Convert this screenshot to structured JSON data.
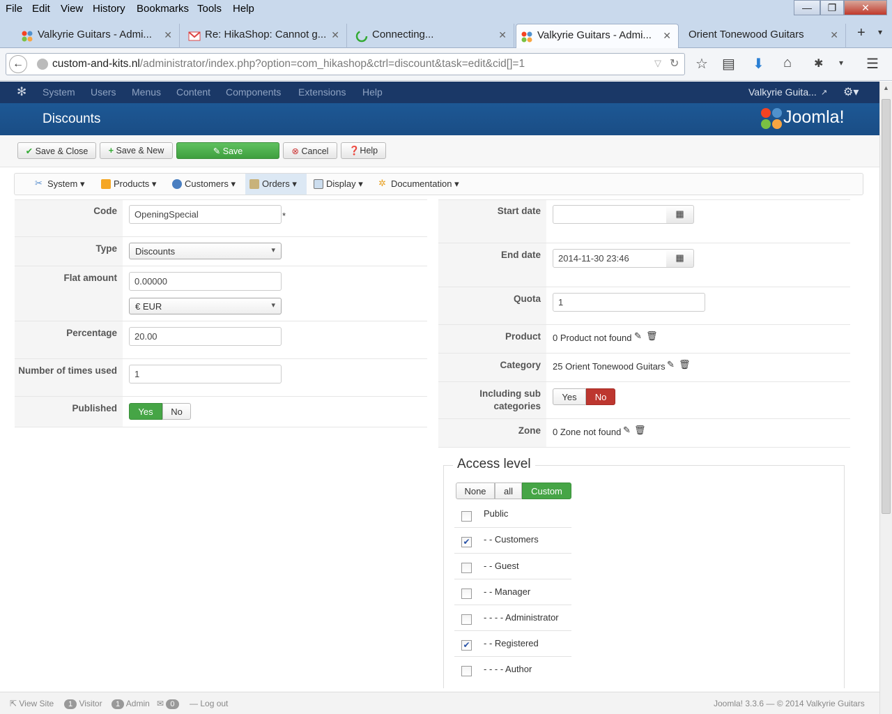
{
  "browser": {
    "menu": [
      "File",
      "Edit",
      "View",
      "History",
      "Bookmarks",
      "Tools",
      "Help"
    ],
    "tabs": [
      {
        "title": "Valkyrie Guitars - Admi...",
        "icon": "joomla-icon"
      },
      {
        "title": "Re: HikaShop: Cannot g...",
        "icon": "gmail-icon"
      },
      {
        "title": "Connecting...",
        "icon": "loading-icon"
      },
      {
        "title": "Valkyrie Guitars - Admi...",
        "icon": "joomla-icon"
      },
      {
        "title": "Orient Tonewood Guitars",
        "icon": ""
      }
    ],
    "url_domain": "custom-and-kits.nl",
    "url_path": "/administrator/index.php?option=com_hikashop&ctrl=discount&task=edit&cid[]=1"
  },
  "joomla": {
    "menu": [
      "System",
      "Users",
      "Menus",
      "Content",
      "Components",
      "Extensions",
      "Help"
    ],
    "site_link": "Valkyrie Guita...",
    "page_title": "Discounts",
    "logo_text": "Joomla!",
    "toolbar": {
      "save_close": "Save & Close",
      "save_new": "Save & New",
      "save": "Save",
      "cancel": "Cancel",
      "help": "Help"
    },
    "hika_menu": [
      "System",
      "Products",
      "Customers",
      "Orders",
      "Display",
      "Documentation"
    ]
  },
  "form_left": {
    "code_label": "Code",
    "code_value": "OpeningSpecial",
    "required_mark": "*",
    "type_label": "Type",
    "type_value": "Discounts",
    "flat_label": "Flat amount",
    "flat_value": "0.00000",
    "currency_value": "€ EUR",
    "percentage_label": "Percentage",
    "percentage_value": "20.00",
    "times_label": "Number of times used",
    "times_value": "1",
    "published_label": "Published",
    "yes": "Yes",
    "no": "No"
  },
  "form_right": {
    "start_label": "Start date",
    "start_value": "",
    "end_label": "End date",
    "end_value": "2014-11-30 23:46",
    "quota_label": "Quota",
    "quota_value": "1",
    "product_label": "Product",
    "product_value": "0 Product not found",
    "category_label": "Category",
    "category_value": "25 Orient Tonewood Guitars",
    "subcat_label_1": "Including sub",
    "subcat_label_2": "categories",
    "yes": "Yes",
    "no": "No",
    "zone_label": "Zone",
    "zone_value": "0 Zone not found"
  },
  "access": {
    "legend": "Access level",
    "none": "None",
    "all": "all",
    "custom": "Custom",
    "groups": [
      {
        "label": "Public",
        "checked": false
      },
      {
        "label": "- - Customers",
        "checked": true
      },
      {
        "label": "- - Guest",
        "checked": false
      },
      {
        "label": "- - Manager",
        "checked": false
      },
      {
        "label": "- - - - Administrator",
        "checked": false
      },
      {
        "label": "- - Registered",
        "checked": true
      },
      {
        "label": "- - - - Author",
        "checked": false
      }
    ]
  },
  "status": {
    "view_site": "View Site",
    "visitor_count": "1",
    "visitor": "Visitor",
    "admin_count": "1",
    "admin": "Admin",
    "msg_count": "0",
    "logout": "Log out",
    "footer": "Joomla! 3.3.6 — © 2014 Valkyrie Guitars"
  }
}
